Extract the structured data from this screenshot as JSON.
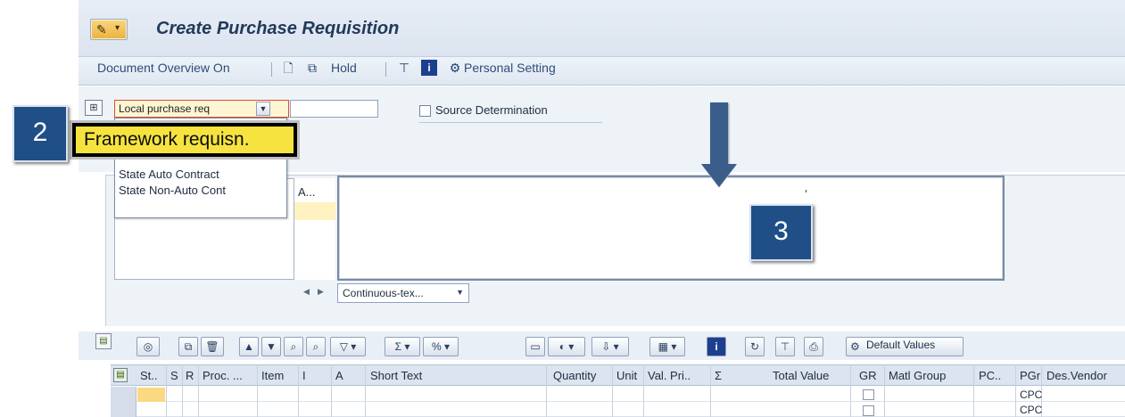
{
  "window": {
    "title": "Create Purchase Requisition"
  },
  "toolbar": {
    "document_overview": "Document Overview On",
    "hold": "Hold",
    "personal_setting": "Personal Setting"
  },
  "header": {
    "document_type": {
      "value": "Local purchase req"
    },
    "source_determination": {
      "label": "Source Determination",
      "checked": false
    }
  },
  "dropdown": {
    "items": [
      "State Auto Contract",
      "State Non-Auto Cont"
    ]
  },
  "callouts": {
    "framework": "Framework requisn.",
    "step_2": "2",
    "step_3": "3"
  },
  "texts_panel": {
    "col_a_header": "A...",
    "editor_mode": "Continuous-tex..."
  },
  "items_toolbar": {
    "default_values": "Default Values"
  },
  "grid": {
    "columns": [
      "St..",
      "S",
      "R",
      "Proc. ...",
      "Item",
      "I",
      "A",
      "Short Text",
      "Quantity",
      "Unit",
      "Val. Pri..",
      "Σ",
      "Total Value",
      "GR",
      "Matl Group",
      "PC..",
      "PGr",
      "Des.Vendor"
    ],
    "rows": [
      {
        "pgr": "CPC"
      },
      {
        "pgr": "CPC"
      }
    ]
  },
  "colors": {
    "title_text": "#223a5a",
    "callout_fill": "#f7e33f",
    "badge_fill": "#1f4f86",
    "required_border": "#e04b34"
  },
  "icons": [
    "menu-icon",
    "new-document-icon",
    "copy-icon",
    "org-structure-icon",
    "info-icon",
    "personal-setting-icon",
    "cart-icon",
    "down-arrow-icon"
  ]
}
